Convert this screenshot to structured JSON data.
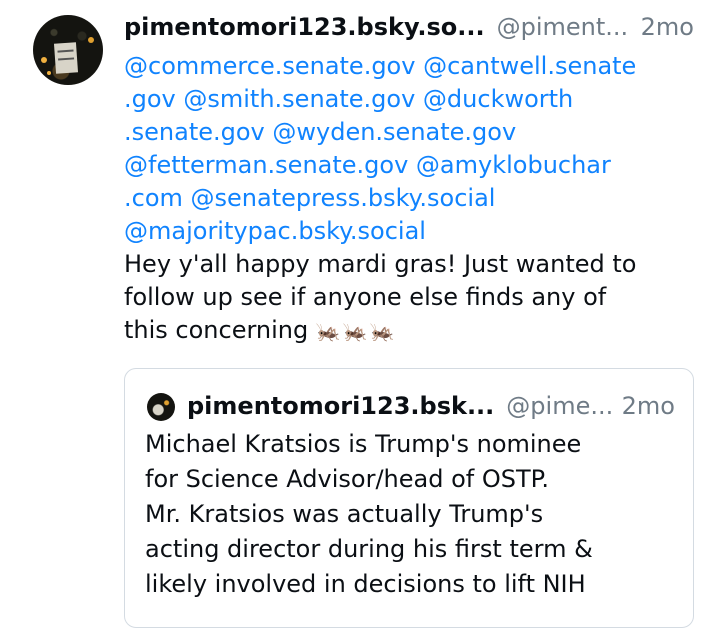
{
  "post": {
    "display_name": "pimentomori123.bsky.so...",
    "handle": "@piment...",
    "time": "2mo",
    "mention_lines": [
      "@commerce.senate.gov @cantwell.senate",
      ".gov @smith.senate.gov @duckworth",
      ".senate.gov  @wyden.senate.gov",
      "@fetterman.senate.gov @amyklobuchar",
      ".com @senatepress.bsky.social",
      "@majoritypac.bsky.social"
    ],
    "text_lines": [
      "Hey y'all happy mardi gras! Just wanted to",
      "follow up see if anyone else finds any of",
      "this concerning"
    ],
    "emoji": "🦗🦗🦗"
  },
  "quote": {
    "display_name": "pimentomori123.bsk...",
    "handle": "@pime...",
    "time": "2mo",
    "text_lines": [
      "Michael Kratsios is Trump's nominee",
      "for Science Advisor/head of OSTP.",
      "Mr. Kratsios was actually Trump's",
      "acting director during his first term &",
      "likely involved in decisions to lift NIH"
    ]
  }
}
